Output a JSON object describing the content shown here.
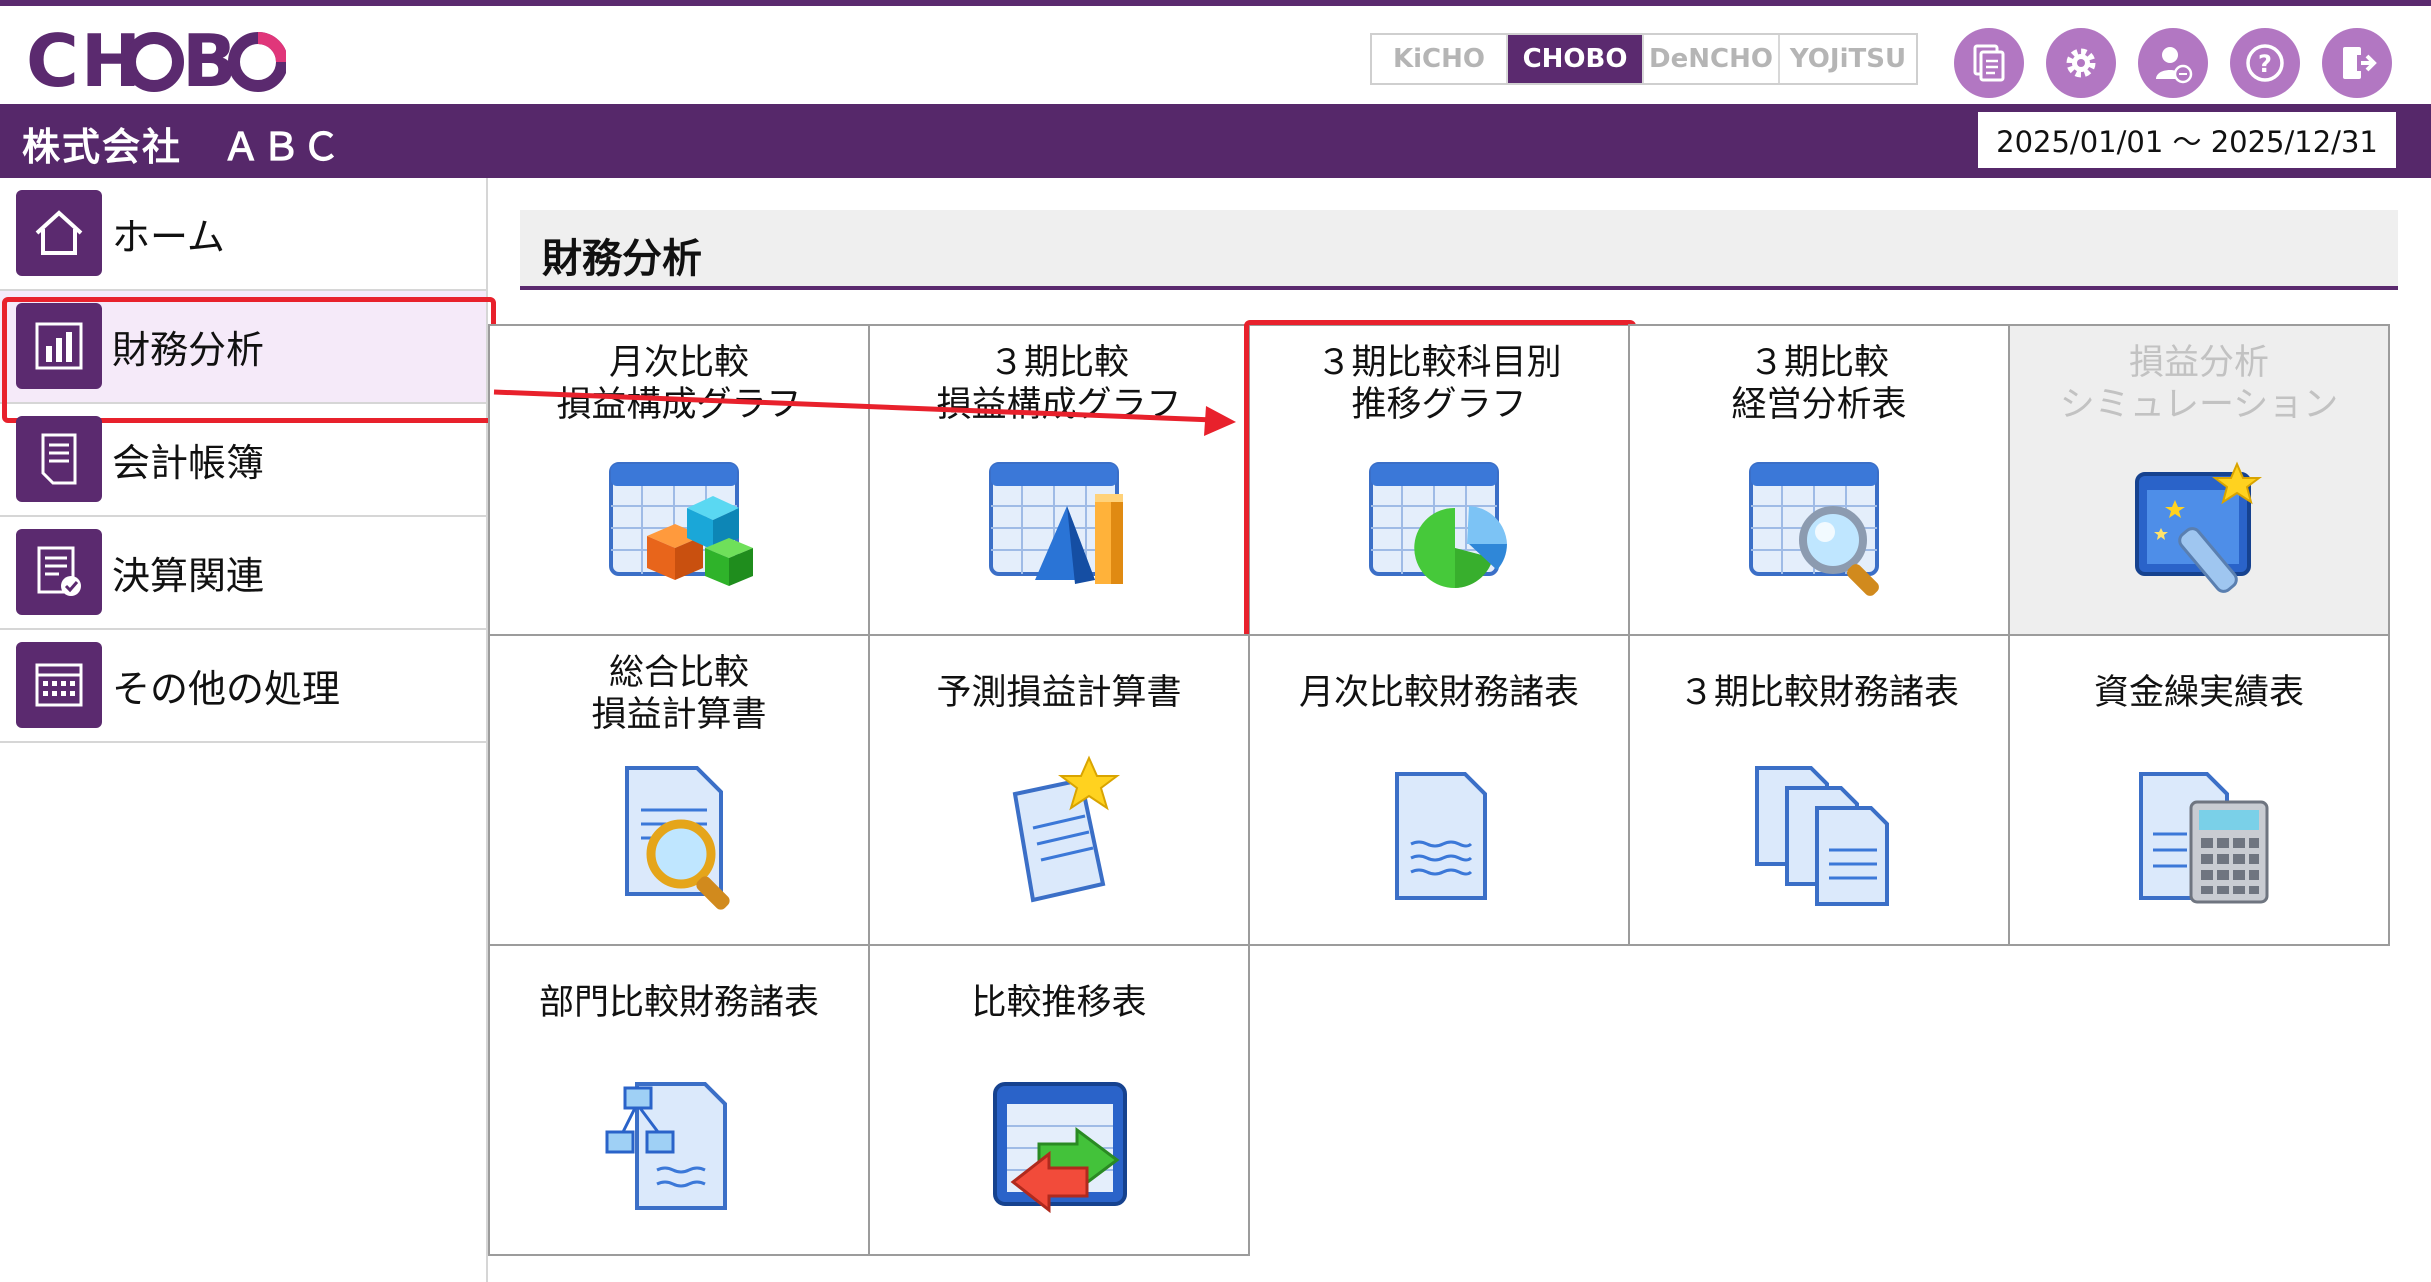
{
  "header": {
    "logo_text": "CHOBO",
    "modes": [
      {
        "label": "KiCHO",
        "active": false
      },
      {
        "label": "CHOBO",
        "active": true
      },
      {
        "label": "DeNCHO",
        "active": false
      },
      {
        "label": "YOJiTSU",
        "active": false
      }
    ],
    "icons": [
      "documents-icon",
      "gear-icon",
      "user-settings-icon",
      "help-icon",
      "logout-icon"
    ]
  },
  "company_bar": {
    "company_name": "株式会社　ＡＢＣ",
    "period": "2025/01/01 ～ 2025/12/31"
  },
  "sidebar": {
    "items": [
      {
        "label": "ホーム",
        "icon": "home-icon",
        "active": false
      },
      {
        "label": "財務分析",
        "icon": "bar-chart-icon",
        "active": true
      },
      {
        "label": "会計帳簿",
        "icon": "ledger-icon",
        "active": false
      },
      {
        "label": "決算関連",
        "icon": "settlement-icon",
        "active": false
      },
      {
        "label": "その他の処理",
        "icon": "calendar-icon",
        "active": false
      }
    ]
  },
  "main": {
    "title": "財務分析",
    "tiles": [
      {
        "label": "月次比較\n損益構成グラフ",
        "icon": "cubes-chart-icon",
        "disabled": false,
        "highlight": false
      },
      {
        "label": "３期比較\n損益構成グラフ",
        "icon": "bar-cone-chart-icon",
        "disabled": false,
        "highlight": false
      },
      {
        "label": "３期比較科目別\n推移グラフ",
        "icon": "pie-chart-icon",
        "disabled": false,
        "highlight": true
      },
      {
        "label": "３期比較\n経営分析表",
        "icon": "magnifier-chart-icon",
        "disabled": false,
        "highlight": false
      },
      {
        "label": "損益分析\nシミュレーション",
        "icon": "wand-icon",
        "disabled": true,
        "highlight": false
      },
      {
        "label": "総合比較\n損益計算書",
        "icon": "magnifier-document-icon",
        "disabled": false,
        "highlight": false
      },
      {
        "label": "予測損益計算書",
        "icon": "star-document-icon",
        "disabled": false,
        "highlight": false
      },
      {
        "label": "月次比較財務諸表",
        "icon": "document-icon",
        "disabled": false,
        "highlight": false
      },
      {
        "label": "３期比較財務諸表",
        "icon": "stacked-documents-icon",
        "disabled": false,
        "highlight": false
      },
      {
        "label": "資金繰実績表",
        "icon": "calculator-document-icon",
        "disabled": false,
        "highlight": false
      },
      {
        "label": "部門比較財務諸表",
        "icon": "network-document-icon",
        "disabled": false,
        "highlight": false
      },
      {
        "label": "比較推移表",
        "icon": "transfer-window-icon",
        "disabled": false,
        "highlight": false
      }
    ]
  },
  "colors": {
    "brand_purple": "#5b2a6f",
    "bar_purple": "#56286a",
    "icon_purple": "#b277c2",
    "highlight_red": "#e8212c"
  }
}
